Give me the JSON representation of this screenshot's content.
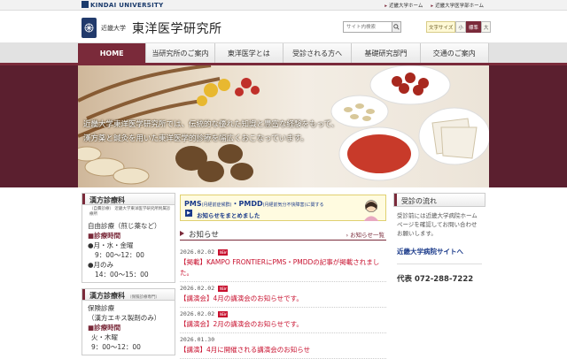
{
  "topbar": {
    "university": "KINDAI UNIVERSITY",
    "links": [
      "近畿大学ホーム",
      "近畿大学医学部ホーム"
    ]
  },
  "header": {
    "sub_title": "近畿大学",
    "title": "東洋医学研究所",
    "search_placeholder": "サイト内検索",
    "font_size_label": "文字サイズ",
    "font_size_options": [
      "小",
      "標準",
      "大"
    ],
    "font_size_selected": "標準"
  },
  "nav": {
    "items": [
      "HOME",
      "当研究所のご案内",
      "東洋医学とは",
      "受診される方へ",
      "基礎研究部門",
      "交通のご案内"
    ]
  },
  "hero": {
    "caption_line1": "近畿大学東洋医学研究所では、伝統的な優れた知識と豊富な経験をもって、",
    "caption_line2": "漢方薬と鍼灸を用いた東洋医学的診療を幅広くおこなっています。"
  },
  "left": {
    "box1": {
      "title": "漢方診療科",
      "subtitle": "（自費診療） 近畿大学東洋医学研究所附属診療所",
      "line1": "自由診療（煎じ薬など）",
      "hours_head": "診療時間",
      "d1": "●月・水・金曜",
      "t1": "9：00～12：00",
      "d2": "●月のみ",
      "t2": "14：00～15：00"
    },
    "box2": {
      "title": "漢方診療科",
      "subtitle": "（保険診療専門）",
      "line1": "保険診療",
      "line2": "（漢方エキス製剤のみ）",
      "hours_head": "診療時間",
      "d1": "火・木曜",
      "t1": "9：00～12：00"
    }
  },
  "banner": {
    "line1": "PMS",
    "line1_small": "(月経前症候群)",
    "line1_mid": "・PMDD",
    "line1_small2": "(月経前気分不快障害)",
    "line1_end": "に関する",
    "line2": "お知らせをまとめました"
  },
  "news": {
    "title": "お知らせ",
    "more": "お知らせ一覧",
    "new_label": "NEW",
    "items": [
      {
        "date": "2026.02.02",
        "is_new": true,
        "text": "【掲載】KAMPO FRONTIERにPMS・PMDDの記事が掲載されました。"
      },
      {
        "date": "2026.02.02",
        "is_new": true,
        "text": "【講演会】4月の講演会のお知らせです。"
      },
      {
        "date": "2026.02.02",
        "is_new": true,
        "text": "【講演会】2月の講演会のお知らせです。"
      },
      {
        "date": "2026.01.30",
        "is_new": false,
        "text": "【講演】4月に開催される講演会のお知らせ"
      }
    ]
  },
  "right": {
    "title": "受診の流れ",
    "text": "受診前には近畿大学病院ホームページを確認してお問い合わせお願いします。",
    "link": "近畿大学病院サイトへ",
    "tel": "代表 072-288-7222"
  },
  "colors": {
    "accent": "#7a2a3a",
    "news_red": "#c8102e",
    "navy": "#1a3a6b"
  }
}
